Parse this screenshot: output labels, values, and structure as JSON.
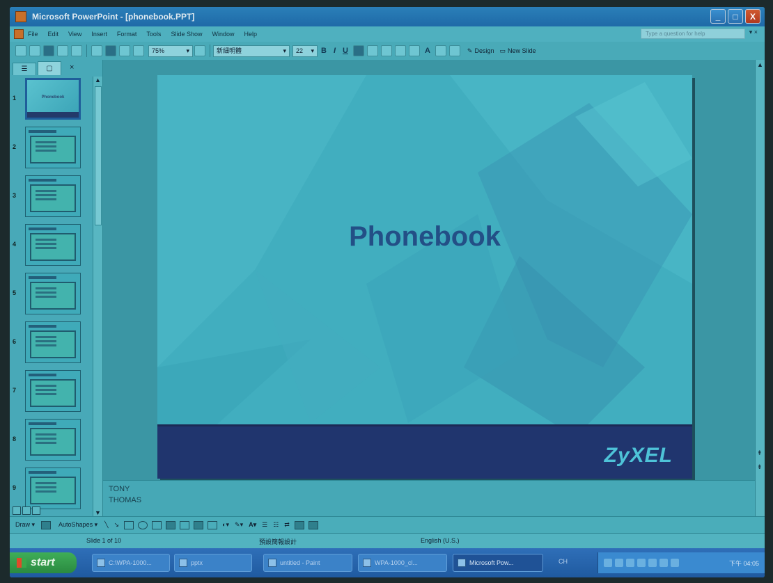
{
  "window": {
    "title": "Microsoft PowerPoint - [phonebook.PPT]",
    "controls": [
      "_",
      "□",
      "X"
    ]
  },
  "menu": {
    "items": [
      "File",
      "Edit",
      "View",
      "Insert",
      "Format",
      "Tools",
      "Slide Show",
      "Window",
      "Help"
    ],
    "help_placeholder": "Type a question for help"
  },
  "toolbar": {
    "zoom": "75%",
    "font": "新細明體",
    "font_size": "22",
    "bold": "B",
    "italic": "I",
    "underline": "U",
    "design_label": "Design",
    "new_slide_label": "New Slide"
  },
  "slide_pane": {
    "tabs": [
      "☰",
      "▢"
    ],
    "close": "×",
    "slides": [
      {
        "num": "1",
        "title": "Phonebook",
        "selected": true
      },
      {
        "num": "2",
        "title": "",
        "selected": false
      },
      {
        "num": "3",
        "title": "",
        "selected": false
      },
      {
        "num": "4",
        "title": "",
        "selected": false
      },
      {
        "num": "5",
        "title": "",
        "selected": false
      },
      {
        "num": "6",
        "title": "",
        "selected": false
      },
      {
        "num": "7",
        "title": "",
        "selected": false
      },
      {
        "num": "8",
        "title": "",
        "selected": false
      },
      {
        "num": "9",
        "title": "",
        "selected": false
      }
    ]
  },
  "slide": {
    "title": "Phonebook",
    "logo": "ZyXEL"
  },
  "notes": {
    "lines": [
      "TONY",
      "THOMAS"
    ]
  },
  "drawing": {
    "draw_label": "Draw ▾",
    "autoshapes_label": "AutoShapes ▾"
  },
  "status": {
    "slide_info": "Slide 1 of 10",
    "design": "預設簡報設計",
    "language": "English (U.S.)"
  },
  "taskbar": {
    "start": "start",
    "tasks": [
      {
        "label": "C:\\WPA-1000...",
        "active": false
      },
      {
        "label": "pptx",
        "active": false
      },
      {
        "label": "untitled - Paint",
        "active": false
      },
      {
        "label": "WPA-1000_cl...",
        "active": false
      },
      {
        "label": "Microsoft Pow...",
        "active": true
      }
    ],
    "lang": "CH",
    "clock": "下午 04:05"
  },
  "colors": {
    "slide_title": "#234f86",
    "footer": "#20356e",
    "logo": "#4ec3d8"
  }
}
